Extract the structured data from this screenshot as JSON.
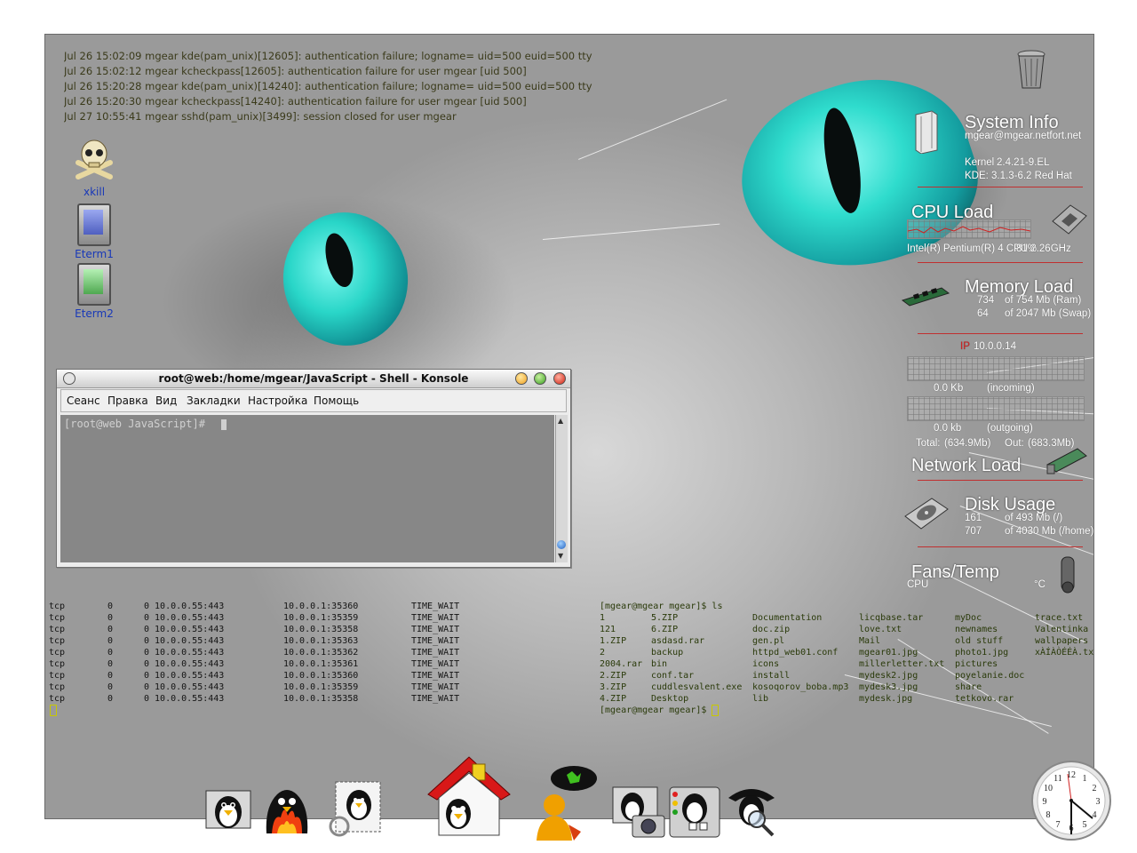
{
  "auth_log": [
    "Jul 26 15:02:09 mgear kde(pam_unix)[12605]: authentication failure; logname= uid=500 euid=500 tty=:0",
    "Jul 26 15:02:12 mgear kcheckpass[12605]: authentication failure for user mgear [uid 500]",
    "Jul 26 15:20:28 mgear kde(pam_unix)[14240]: authentication failure; logname= uid=500 euid=500 tty=:0",
    "Jul 26 15:20:30 mgear kcheckpass[14240]: authentication failure for user mgear [uid 500]",
    "Jul 27 10:55:41 mgear sshd(pam_unix)[3499]: session closed for user mgear"
  ],
  "desktop_icons": {
    "xkill": "xkill",
    "eterm1": "Eterm1",
    "eterm2": "Eterm2"
  },
  "konsole": {
    "title": "root@web:/home/mgear/JavaScript - Shell - Konsole",
    "menu": [
      "Сеанс",
      "Правка",
      "Вид",
      "Закладки",
      "Настройка",
      "Помощь"
    ],
    "prompt": "[root@web JavaScript]#"
  },
  "monitor": {
    "system_info": {
      "title": "System Info",
      "host": "mgear@mgear.netfort.net",
      "kernel_label": "Kernel",
      "kernel": "2.4.21-9.EL",
      "kde": "KDE: 3.1.3-6.2 Red Hat"
    },
    "cpu": {
      "title": "CPU Load",
      "model": "Intel(R) Pentium(R) 4 CPU 2.26GHz",
      "percent": "81%"
    },
    "memory": {
      "title": "Memory Load",
      "ram_used": "734",
      "ram_total": "of 754 Mb (Ram)",
      "swap_used": "64",
      "swap_total": "of 2047 Mb (Swap)"
    },
    "network": {
      "ip_label": "IP",
      "ip": "10.0.0.14",
      "in_rate": "0.0 Kb",
      "in_label": "(incoming)",
      "out_rate": "0.0 kb",
      "out_label": "(outgoing)",
      "total_label": "Total:",
      "total_in": "(634.9Mb)",
      "out_total_label": "Out:",
      "total_out": "(683.3Mb)",
      "title": "Network Load"
    },
    "disk": {
      "title": "Disk Usage",
      "root_used": "161",
      "root_total": "of 493 Mb (/)",
      "home_used": "707",
      "home_total": "of 4030 Mb (/home)"
    },
    "fans": {
      "title": "Fans/Temp",
      "cpu_label": "CPU",
      "unit": "°C"
    }
  },
  "netstat": {
    "rows": [
      [
        "tcp",
        "0",
        "0 10.0.0.55:443",
        "10.0.0.1:35360",
        "TIME_WAIT"
      ],
      [
        "tcp",
        "0",
        "0 10.0.0.55:443",
        "10.0.0.1:35359",
        "TIME_WAIT"
      ],
      [
        "tcp",
        "0",
        "0 10.0.0.55:443",
        "10.0.0.1:35358",
        "TIME_WAIT"
      ],
      [
        "tcp",
        "0",
        "0 10.0.0.55:443",
        "10.0.0.1:35363",
        "TIME_WAIT"
      ],
      [
        "tcp",
        "0",
        "0 10.0.0.55:443",
        "10.0.0.1:35362",
        "TIME_WAIT"
      ],
      [
        "tcp",
        "0",
        "0 10.0.0.55:443",
        "10.0.0.1:35361",
        "TIME_WAIT"
      ],
      [
        "tcp",
        "0",
        "0 10.0.0.55:443",
        "10.0.0.1:35360",
        "TIME_WAIT"
      ],
      [
        "tcp",
        "0",
        "0 10.0.0.55:443",
        "10.0.0.1:35359",
        "TIME_WAIT"
      ],
      [
        "tcp",
        "0",
        "0 10.0.0.55:443",
        "10.0.0.1:35358",
        "TIME_WAIT"
      ]
    ]
  },
  "ls_terminal": {
    "command": "[mgear@mgear mgear]$ ls",
    "columns": [
      [
        "1",
        "121",
        "1.ZIP",
        "2",
        "2004.rar",
        "2.ZIP",
        "3.ZIP",
        "4.ZIP"
      ],
      [
        "5.ZIP",
        "6.ZIP",
        "asdasd.rar",
        "backup",
        "bin",
        "conf.tar",
        "cuddlesvalent.exe",
        "Desktop"
      ],
      [
        "Documentation",
        "doc.zip",
        "gen.pl",
        "httpd_web01.conf",
        "icons",
        "install",
        "kosoqorov_boba.mp3",
        "lib"
      ],
      [
        "licqbase.tar",
        "love.txt",
        "Mail",
        "mgear01.jpg",
        "millerletter.txt",
        "mydesk2.jpg",
        "mydesk3.jpg",
        "mydesk.jpg"
      ],
      [
        "myDoc",
        "newnames",
        "old stuff",
        "photo1.jpg",
        "pictures",
        "poyelanie.doc",
        "share",
        "tetkovo.rar"
      ],
      [
        "trace.txt",
        "Valentinka",
        "wallpapers",
        "xÀÍÀÒÉÉÀ.txt"
      ]
    ],
    "prompt_end": "[mgear@mgear mgear]$"
  },
  "clock": {
    "numbers": [
      "12",
      "1",
      "2",
      "3",
      "4",
      "5",
      "6",
      "7",
      "8",
      "9",
      "10",
      "11"
    ]
  },
  "colors": {
    "eye": "#29d6c8",
    "log_text": "#3a3a1a",
    "link_blue": "#1838b8",
    "monitor_red": "#c03030"
  },
  "dock_icons": [
    "tux-desktop-icon",
    "tux-fire-icon",
    "tux-mail-icon",
    "tux-home-icon",
    "kopete-icon",
    "tux-camera-icon",
    "tux-control-icon",
    "tux-search-icon"
  ]
}
